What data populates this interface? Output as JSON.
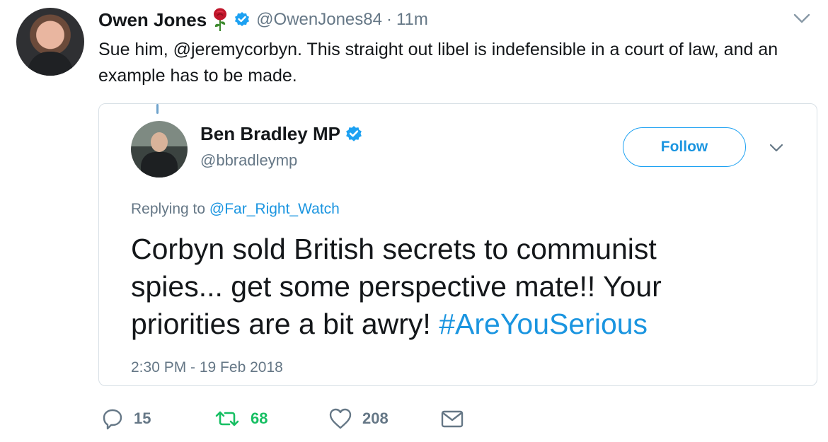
{
  "tweet": {
    "author_name": "Owen Jones",
    "handle": "@OwenJones84",
    "separator": "·",
    "time": "11m",
    "text": "Sue him, @jeremycorbyn. This straight out libel is indefensible in a court of law, and an example has to be made."
  },
  "quoted": {
    "author_name": "Ben Bradley MP",
    "handle": "@bbradleymp",
    "follow_label": "Follow",
    "replying_prefix": "Replying to",
    "replying_to": "@Far_Right_Watch",
    "text": "Corbyn sold British secrets to communist spies... get some perspective mate!! Your priorities are a bit awry!",
    "hashtag": "#AreYouSerious",
    "timestamp": "2:30 PM - 19 Feb 2018"
  },
  "actions": {
    "replies": "15",
    "retweets": "68",
    "likes": "208"
  },
  "colors": {
    "accent": "#1da1f2",
    "link": "#1b95e0",
    "muted": "#657786",
    "retweet": "#17bf63",
    "rose": "#c0152a"
  },
  "icons": [
    "rose-icon",
    "verified-icon",
    "chevron-down-icon",
    "reply-icon",
    "retweet-icon",
    "like-icon",
    "direct-message-icon"
  ]
}
